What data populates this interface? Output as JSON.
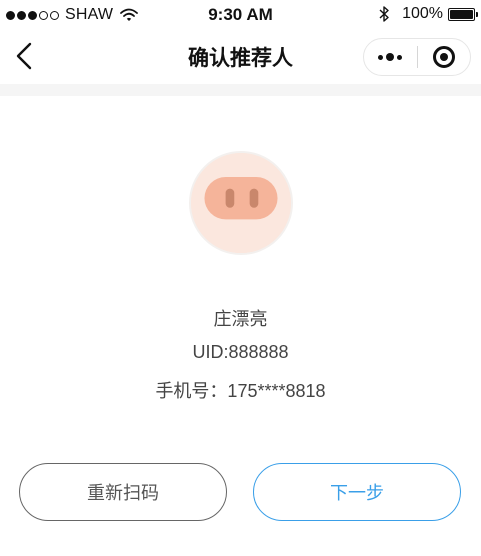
{
  "status_bar": {
    "carrier": "SHAW",
    "time": "9:30 AM",
    "battery_percent": "100%",
    "signal_bars_filled": 3,
    "signal_bars_total": 5,
    "battery_level": 1.0
  },
  "nav": {
    "title": "确认推荐人",
    "back_icon": "chevron-left-icon",
    "more_icon": "more-dots-icon",
    "close_icon": "target-circle-icon"
  },
  "referrer": {
    "name": "庄漂亮",
    "uid": "UID:888888",
    "phone": "手机号：175****8818"
  },
  "actions": {
    "rescan_label": "重新扫码",
    "next_label": "下一步"
  },
  "colors": {
    "accent": "#3a9fe8",
    "avatar_bg": "#fbe7de",
    "snout": "#f5b49a",
    "nostril": "#c9876c",
    "band": "#f5f5f5"
  }
}
